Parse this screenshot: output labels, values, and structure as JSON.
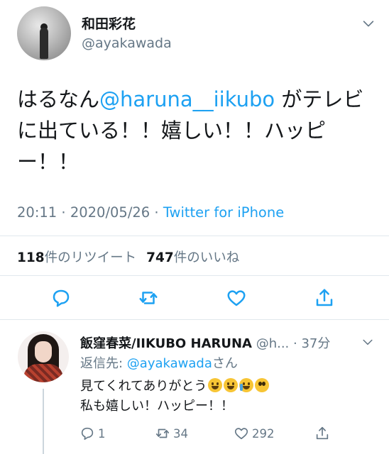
{
  "tweet": {
    "author_name": "和田彩花",
    "author_handle": "@ayakawada",
    "text_before": "はるなん",
    "mention": "@haruna__iikubo",
    "text_after": " がテレビに出ている！！嬉しい！！ハッピー！！",
    "time": "20:11",
    "sep1": " · ",
    "date": "2020/05/26",
    "sep2": " · ",
    "source": "Twitter for iPhone",
    "retweet_count": "118",
    "retweet_label": "件のリツイート",
    "like_count": "747",
    "like_label": "件のいいね"
  },
  "reply": {
    "author_name": "飯窪春菜/IIKUBO HARUNA",
    "author_handle": " @h...",
    "sep": " · ",
    "time_ago": "37分",
    "replying_prefix": "返信先: ",
    "replying_to": "@ayakawada",
    "replying_suffix": "さん",
    "line1": "見てくれてありがとう",
    "line2": "私も嬉しい！ハッピー！！",
    "reply_count": "1",
    "retweet_count": "34",
    "like_count": "292"
  },
  "icons": {
    "main_actions": [
      "comment-icon",
      "retweet-icon",
      "heart-icon",
      "share-icon"
    ],
    "emoji_line1": [
      "laughing-emoji",
      "joy-emoji",
      "crying-emoji",
      "pleading-emoji"
    ]
  },
  "colors": {
    "accent": "#1da1f2",
    "muted": "#657786",
    "text": "#14171a",
    "divider": "#e1e8ed"
  }
}
